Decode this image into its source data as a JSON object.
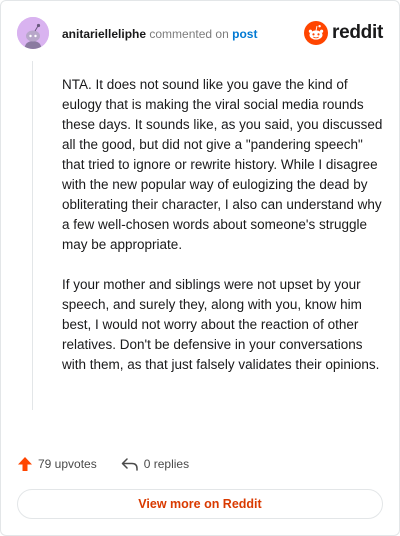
{
  "header": {
    "username": "anitarielleliphe",
    "commented_text": "commented on",
    "post_link": "post",
    "brand": "reddit"
  },
  "comment": {
    "paragraphs": [
      "NTA. It does not sound like you gave the kind of eulogy that is making the viral social media rounds these days. It sounds like, as you said, you discussed all the good, but did not give a \"pandering speech\" that tried to ignore or rewrite history. While I disagree with the new popular way of eulogizing the dead by obliterating their character, I also can understand why a few well-chosen words about someone's struggle may be appropriate.",
      "If your mother and siblings were not upset by your speech, and surely they, along with you, know him best, I would not worry about the reaction of other relatives. Don't be defensive in your conversations with them, as that just falsely validates their opinions."
    ]
  },
  "actions": {
    "upvotes": "79 upvotes",
    "replies": "0 replies"
  },
  "footer": {
    "view_more": "View more on Reddit"
  },
  "colors": {
    "accent": "#d93a00",
    "upvote": "#ff4500",
    "link": "#0079d3",
    "avatar_bg": "#d9b3f0"
  },
  "icons": {
    "avatar": "snoo-avatar",
    "brand": "reddit-logo-icon",
    "upvote": "upvote-arrow-icon",
    "reply": "reply-arrow-icon"
  }
}
